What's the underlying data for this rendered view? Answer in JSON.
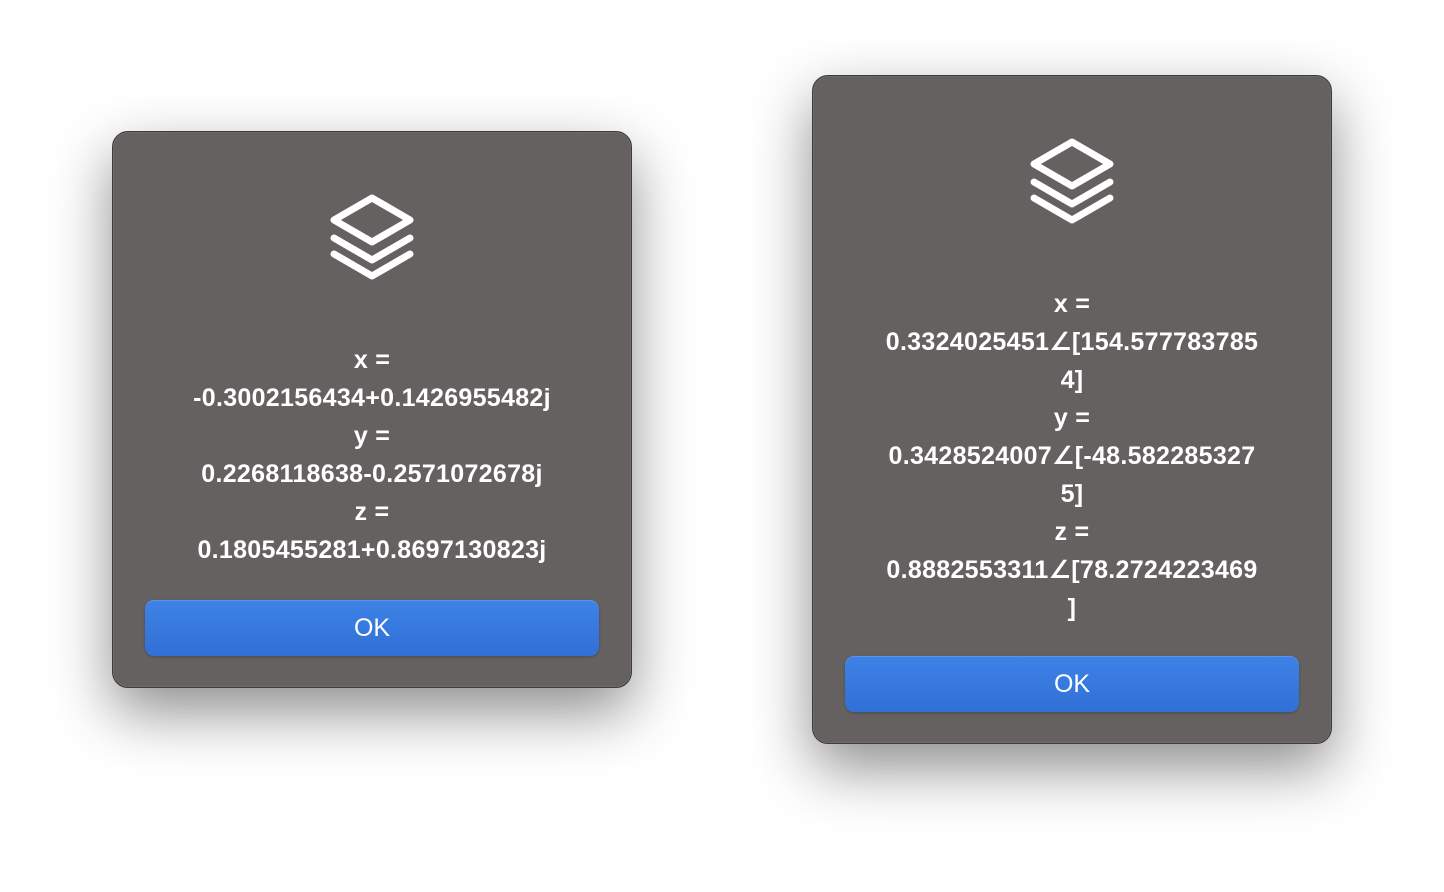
{
  "alerts": [
    {
      "icon": "layers-stack-icon",
      "message_lines": [
        "x =",
        "-0.3002156434+0.1426955482j",
        "y =",
        "0.2268118638-0.2571072678j",
        "z =",
        "0.1805455281+0.8697130823j"
      ],
      "ok_label": "OK"
    },
    {
      "icon": "layers-stack-icon",
      "message_lines": [
        "x =",
        "0.3324025451∠[154.577783785",
        "4]",
        "y =",
        "0.3428524007∠[-48.582285327",
        "5]",
        "z =",
        "0.8882553311∠[78.2724223469",
        "]"
      ],
      "ok_label": "OK"
    }
  ],
  "colors": {
    "dialog_background": "#646160",
    "button_accent": "#3a7be0",
    "text": "#ffffff"
  }
}
